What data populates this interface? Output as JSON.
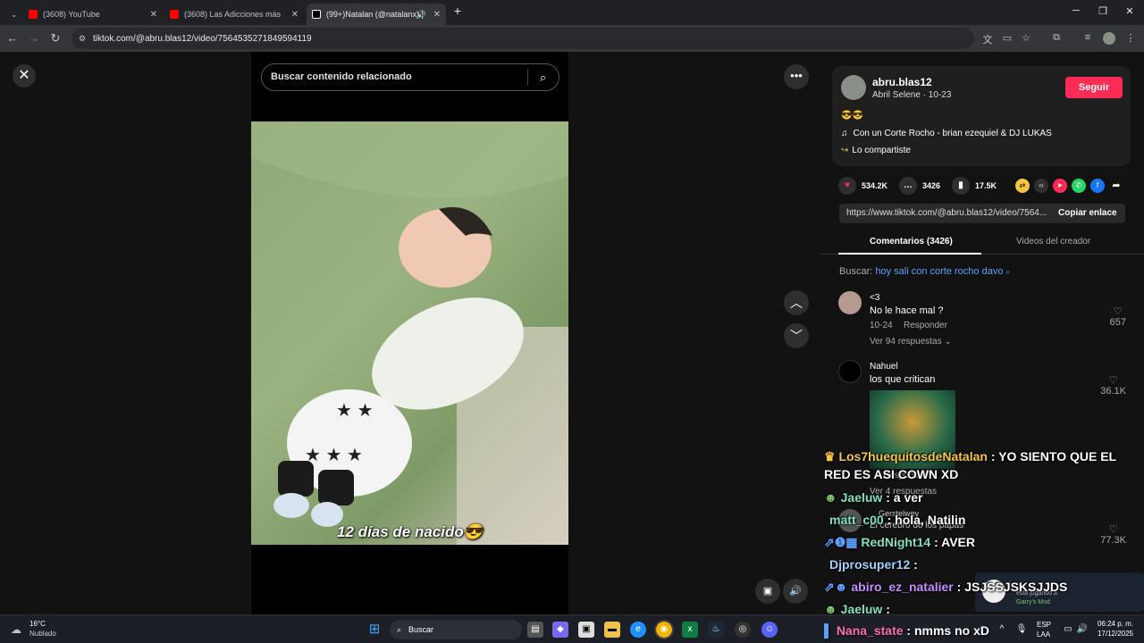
{
  "browser": {
    "tabs": [
      {
        "label": "(3608) YouTube"
      },
      {
        "label": "(3608) Las Adicciones más Perturbadoras"
      },
      {
        "label": "(99+)Natalan (@natalanx) |"
      }
    ],
    "url": "tiktok.com/@abru.blas12/video/7564535271849594119"
  },
  "video": {
    "search_placeholder": "Buscar contenido relacionado",
    "caption": "12 días de nacido😎"
  },
  "creator": {
    "username": "abru.blas12",
    "subtitle": "Abril Selene · 10-23",
    "follow_label": "Seguir",
    "emojis": "😎😎",
    "music": "Con un Corte Rocho - brian ezequiel & DJ LUKAS",
    "shared_label": "Lo compartiste"
  },
  "stats": {
    "likes": "534.2K",
    "comments": "3426",
    "saves": "17.5K"
  },
  "link": {
    "url": "https://www.tiktok.com/@abru.blas12/video/7564...",
    "copy_label": "Copiar enlace"
  },
  "panel_tabs": {
    "comments": "Comentarios (3426)",
    "creator_videos": "Videos del creador"
  },
  "search_suggest": {
    "prefix": "Buscar:",
    "query": "hoy sali con corte rocho davo"
  },
  "comments": [
    {
      "user": "<3",
      "text": "No le hace mal ?",
      "date": "10-24",
      "reply": "Responder",
      "likes": "657",
      "replies": "Ver 94 respuestas"
    },
    {
      "user": "Nahuel",
      "text": "los que critican",
      "likes": "36.1K",
      "reply": "Responder",
      "replies": "Ver 4 respuestas"
    },
    {
      "user": "Gerstelwey",
      "text": "El cerebro de los papas",
      "likes": "77.3K"
    }
  ],
  "chat": [
    {
      "user": "Los7huequitosdeNatalan",
      "text": ": YO SIENTO QUE EL RED ES ASI COWN XD",
      "color": "#f5c542"
    },
    {
      "user": "Jaeluw",
      "text": ": a ver",
      "color": "#7fe3c0"
    },
    {
      "user": "matt_c00",
      "text": ": hola, Natilin",
      "color": "#7fe3c0"
    },
    {
      "user": "RedNight14",
      "text": ": AVER",
      "color": "#7fe3c0"
    },
    {
      "user": "Djprosuper12",
      "text": ":",
      "color": "#9ad3ff"
    },
    {
      "user": "abiro_ez_natalier",
      "text": ": JSJSSJSKSJJDS",
      "color": "#c78bff"
    },
    {
      "user": "Jaeluw",
      "text": ":",
      "color": "#7fe3c0"
    },
    {
      "user": "Nana_state",
      "text": ": nmms no xD",
      "color": "#ff6fae"
    }
  ],
  "game_toast": {
    "line1": "está jugando a",
    "line2": "Garry's Mod"
  },
  "taskbar": {
    "weather_temp": "16°C",
    "weather_desc": "Nublado",
    "search_label": "Buscar",
    "lang1": "ESP",
    "lang2": "LAA",
    "time": "06:24 p. m.",
    "date": "17/12/2025"
  }
}
